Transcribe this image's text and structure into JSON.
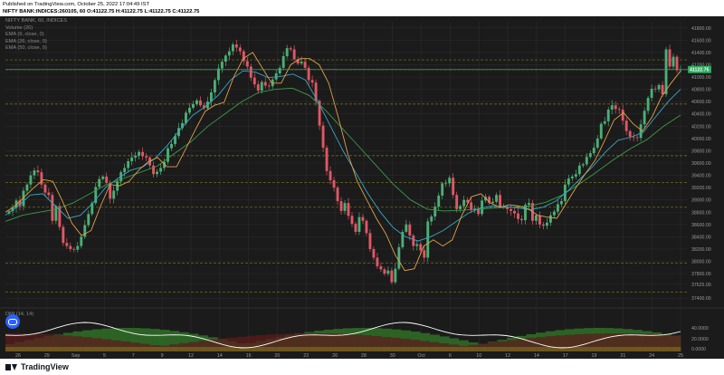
{
  "header": {
    "published": "Published on TradingView.com, October 25, 2022 17:04:49 IST",
    "ohlc": "NIFTY BANK:INDICES:260105, 60  O:41122.75 H:41122.75 L:41122.75 C:41122.75"
  },
  "legend": {
    "symbol": "NIFTY BANK, 60, INDICES",
    "volume": "Volume (20)",
    "ema9": "EMA (9, close, 0)",
    "ema26": "EMA (26, close, 0)",
    "ema50": "EMA (50, close, 0)"
  },
  "dmi_label": "DMI (14, 14)",
  "footer": {
    "brand": "TradingView"
  },
  "colors": {
    "background": "#1b1b1b",
    "up": "#4caf76",
    "down": "#e05866",
    "ema9": "#e0a04a",
    "ema26": "#35a7c6",
    "ema50": "#3d9a4a",
    "grid": "#2b2b2b",
    "hline": "#7d7a1e",
    "last_price_badge": "#2faa5f",
    "dmi_line": "#ffffff",
    "dmi_green": "#2f6b27",
    "dmi_red": "#5b1c1c",
    "dmi_yellow": "#77621d"
  },
  "chart_data": {
    "type": "candlestick",
    "timeframe": "60",
    "x_ticks": [
      "26",
      "29",
      "Sep",
      "5",
      "7",
      "9",
      "12",
      "14",
      "16",
      "20",
      "22",
      "26",
      "28",
      "30",
      "Oct",
      "6",
      "10",
      "12",
      "14",
      "17",
      "19",
      "21",
      "24",
      "25"
    ],
    "y_ticks": [
      41800,
      41600,
      41400,
      41200,
      41000,
      40800,
      40600,
      40400,
      40200,
      40000,
      39800,
      39600,
      39400,
      39200,
      39000,
      38800,
      38600,
      38400,
      38200,
      38000,
      37800,
      37625,
      37400
    ],
    "ylim": [
      37300,
      41900
    ],
    "last_price": "41122.75",
    "horizontal_levels": [
      41280,
      41120,
      40560,
      39720,
      39280,
      38880,
      37970,
      37500
    ],
    "close": [
      38815,
      38870,
      38990,
      38900,
      39150,
      39250,
      39400,
      39480,
      39450,
      39250,
      39120,
      39080,
      38660,
      38900,
      38560,
      38300,
      38250,
      38200,
      38190,
      38250,
      38400,
      38590,
      38770,
      38950,
      39210,
      39340,
      39380,
      39280,
      39020,
      39150,
      39300,
      39450,
      39520,
      39630,
      39690,
      39720,
      39780,
      39710,
      39690,
      39560,
      39420,
      39460,
      39520,
      39620,
      39840,
      39910,
      40040,
      40170,
      40250,
      40420,
      40500,
      40560,
      40620,
      40540,
      40490,
      40600,
      40750,
      40950,
      41140,
      41250,
      41350,
      41420,
      41530,
      41480,
      41420,
      41260,
      41170,
      40990,
      40880,
      40780,
      40920,
      40860,
      40850,
      40960,
      41060,
      41150,
      41340,
      41470,
      41450,
      41290,
      41220,
      41250,
      41150,
      40950,
      40910,
      40610,
      40210,
      39850,
      39470,
      39320,
      39200,
      38980,
      38820,
      38950,
      38740,
      38610,
      38480,
      38720,
      38660,
      38460,
      38200,
      38060,
      37920,
      37870,
      37800,
      37850,
      37660,
      37880,
      38230,
      38480,
      38600,
      38420,
      38250,
      38280,
      38180,
      38060,
      38650,
      38730,
      38890,
      39070,
      39270,
      39270,
      39360,
      39080,
      38850,
      38900,
      39000,
      38960,
      38830,
      38860,
      38770,
      38990,
      39050,
      38950,
      38970,
      39080,
      38890,
      38880,
      38850,
      38820,
      38780,
      38690,
      38670,
      38920,
      38950,
      38660,
      38750,
      38600,
      38580,
      38630,
      38750,
      38810,
      38930,
      38980,
      39250,
      39350,
      39380,
      39420,
      39560,
      39580,
      39700,
      39760,
      39850,
      40000,
      40240,
      40280,
      40470,
      40540,
      40480,
      40470,
      40290,
      40120,
      40030,
      40020,
      40010,
      40230,
      40450,
      40660,
      40810,
      40800,
      40870,
      40720,
      41450,
      41170,
      41330,
      41110,
      41122.75
    ],
    "ema9_approx": [
      38800,
      38900,
      39050,
      39200,
      39330,
      39300,
      38980,
      38620,
      38420,
      38500,
      38900,
      39250,
      39230,
      39300,
      39480,
      39620,
      39690,
      39540,
      39540,
      39840,
      40150,
      40440,
      40540,
      40590,
      41000,
      41300,
      41400,
      41150,
      40900,
      40900,
      41200,
      41300,
      41300,
      41200,
      40900,
      40350,
      39750,
      39300,
      39000,
      38700,
      38450,
      38100,
      37850,
      37880,
      38250,
      38350,
      38250,
      38350,
      38750,
      39050,
      39100,
      38950,
      38880,
      38920,
      38900,
      38850,
      38750,
      38720,
      38700,
      38950,
      39200,
      39430,
      39640,
      39960,
      40300,
      40420,
      40240,
      40120,
      40350,
      40680,
      40900,
      41100
    ],
    "ema26_approx": [
      38750,
      38900,
      39080,
      39100,
      38900,
      38700,
      38750,
      38950,
      39200,
      39350,
      39480,
      39540,
      39680,
      39900,
      40150,
      40380,
      40520,
      40700,
      40950,
      41100,
      41080,
      40990,
      41010,
      41050,
      40950,
      40600,
      40200,
      39800,
      39450,
      39100,
      38800,
      38550,
      38400,
      38330,
      38400,
      38500,
      38640,
      38780,
      38870,
      38900,
      38890,
      38870,
      38840,
      38880,
      38980,
      39150,
      39350,
      39550,
      39780,
      39970,
      40020,
      40100,
      40350,
      40600,
      40800
    ],
    "ema50_approx": [
      38650,
      38750,
      38800,
      38850,
      38950,
      39100,
      39250,
      39350,
      39450,
      39550,
      39750,
      39950,
      40200,
      40400,
      40600,
      40750,
      40800,
      40820,
      40700,
      40450,
      40150,
      39850,
      39550,
      39250,
      39000,
      38850,
      38820,
      38830,
      38850,
      38870,
      38880,
      38900,
      38960,
      39080,
      39260,
      39450,
      39650,
      39830,
      39980,
      40200,
      40380
    ]
  }
}
